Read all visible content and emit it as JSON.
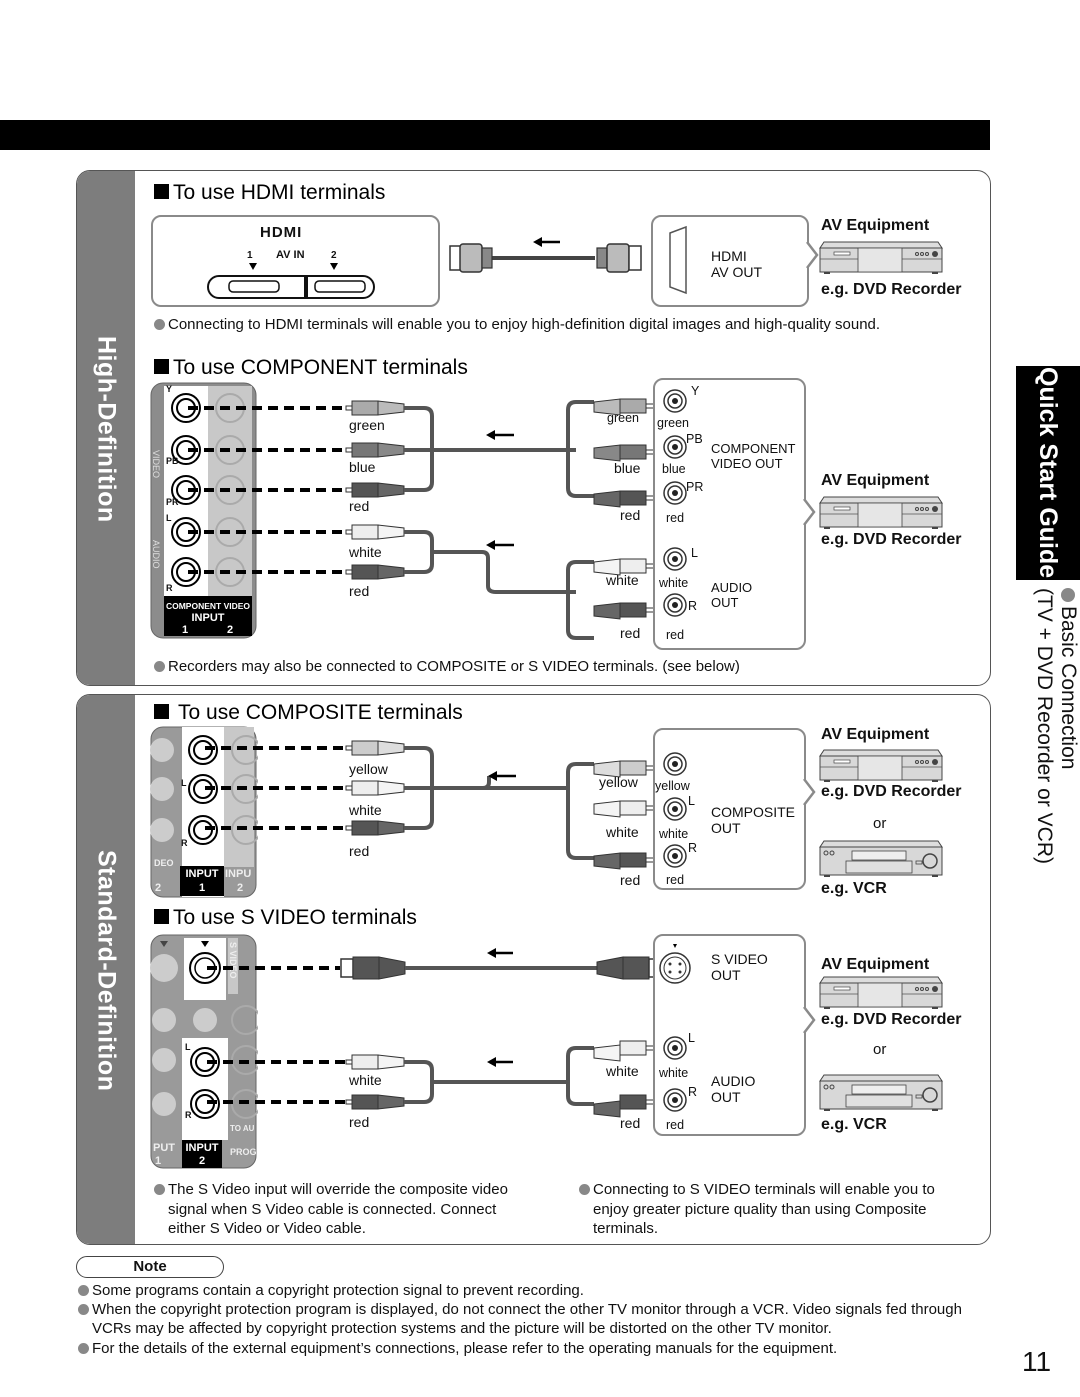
{
  "page_number": "11",
  "right_tab": {
    "title": "Quick Start Guide",
    "subtitle_line1": "Basic Connection",
    "subtitle_line2": "(TV + DVD Recorder or VCR)"
  },
  "hd_panel": {
    "side_label": "High-Definition",
    "hdmi": {
      "heading": "To use HDMI terminals",
      "tv_logo": "HDMI",
      "tv_port_label": "AV IN",
      "port_1": "1",
      "port_2": "2",
      "equipment_port": "HDMI\nAV OUT",
      "equipment_port_line1": "HDMI",
      "equipment_port_line2": "AV OUT",
      "av_equipment": "AV Equipment",
      "device": "e.g. DVD Recorder",
      "note": "Connecting to HDMI terminals will enable you to enjoy high-definition digital images and high-quality sound."
    },
    "component": {
      "heading": "To use COMPONENT terminals",
      "tv_jacks": [
        "Y",
        "PB",
        "PR",
        "L",
        "R"
      ],
      "tv_side_labels": [
        "VIDEO",
        "AUDIO"
      ],
      "tv_input_label_1": "COMPONENT VIDEO",
      "tv_input_label_2": "INPUT",
      "tv_input_nums": [
        "1",
        "2"
      ],
      "cable_labels_tv": [
        "green",
        "blue",
        "red",
        "white",
        "red"
      ],
      "cable_labels_eq": [
        "green",
        "blue",
        "red",
        "white",
        "red"
      ],
      "jack_labels_eq": [
        "green",
        "blue",
        "red",
        "white",
        "red"
      ],
      "jack_letters_eq": [
        "Y",
        "PB",
        "PR",
        "L",
        "R"
      ],
      "video_out_line1": "COMPONENT",
      "video_out_line2": "VIDEO OUT",
      "audio_out_line1": "AUDIO",
      "audio_out_line2": "OUT",
      "av_equipment": "AV Equipment",
      "device": "e.g. DVD Recorder",
      "note": "Recorders may also be connected to COMPOSITE or S VIDEO terminals. (see below)"
    }
  },
  "sd_panel": {
    "side_label": "Standard-Definition",
    "composite": {
      "heading": "To use COMPOSITE terminals",
      "tv_input_label": "INPUT",
      "tv_input_num": "1",
      "tv_side_text_left": "DEO",
      "tv_side_text_right": "INPU",
      "tv_num_left": "2",
      "tv_num_right": "2",
      "tv_jacks": [
        "",
        "L",
        "R"
      ],
      "cable_labels_tv": [
        "yellow",
        "white",
        "red"
      ],
      "cable_labels_eq": [
        "yellow",
        "white",
        "red"
      ],
      "jack_labels_eq": [
        "yellow",
        "white",
        "red"
      ],
      "jack_letters_eq": [
        "",
        "L",
        "R"
      ],
      "out_line1": "COMPOSITE",
      "out_line2": "OUT",
      "av_equipment": "AV Equipment",
      "device_1": "e.g. DVD Recorder",
      "or": "or",
      "device_2": "e.g. VCR"
    },
    "svideo": {
      "heading": "To use S VIDEO terminals",
      "tv_input_label": "INPUT",
      "tv_input_num": "2",
      "tv_side_svideo": "S VIDEO",
      "tv_text_put": "PUT",
      "tv_text_put_num": "1",
      "tv_text_prog": "PROG",
      "tv_text_to_au": "TO AU",
      "tv_jacks": [
        "L",
        "R"
      ],
      "cable_labels_tv": [
        "white",
        "red"
      ],
      "cable_labels_eq": [
        "white",
        "red"
      ],
      "jack_labels_eq": [
        "white",
        "red"
      ],
      "jack_letters_eq": [
        "L",
        "R"
      ],
      "svideo_out_line1": "S VIDEO",
      "svideo_out_line2": "OUT",
      "audio_out_line1": "AUDIO",
      "audio_out_line2": "OUT",
      "av_equipment": "AV Equipment",
      "device_1": "e.g. DVD Recorder",
      "or": "or",
      "device_2": "e.g. VCR",
      "note_left": "The S Video input will override the composite video signal when S Video cable is connected. Connect either S Video or Video cable.",
      "note_right": "Connecting to S VIDEO terminals will enable you to enjoy greater picture quality than using Composite terminals."
    }
  },
  "notes": {
    "title": "Note",
    "items": [
      "Some programs contain a copyright protection signal to prevent recording.",
      "When the copyright protection program is displayed, do not connect the other TV monitor through a VCR. Video signals fed through VCRs may be affected by copyright protection systems and the picture will be distorted on the other TV monitor.",
      "For the details of the external equipment’s connections, please refer to the operating manuals for the equipment."
    ]
  },
  "colors": {
    "side_panel": "#7d7d7d",
    "bullet": "#888888",
    "box_border": "#8a8a8a",
    "black": "#000000"
  }
}
